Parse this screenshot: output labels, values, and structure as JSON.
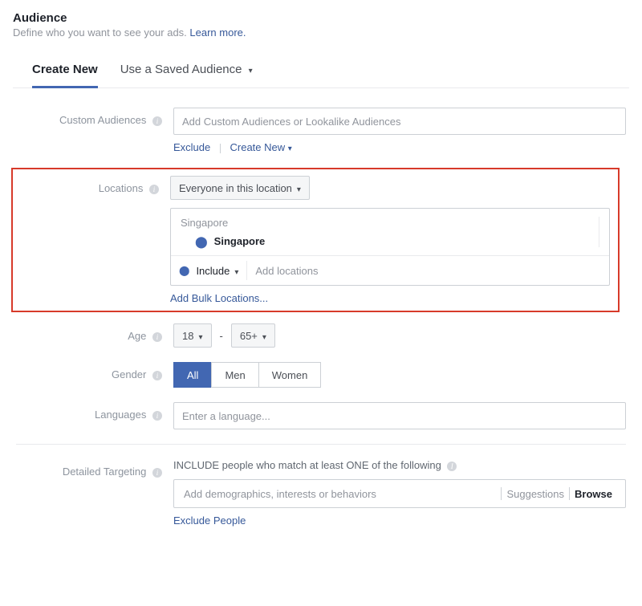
{
  "header": {
    "title": "Audience",
    "subtitle_prefix": "Define who you want to see your ads. ",
    "learn_more": "Learn more."
  },
  "tabs": {
    "create_new": "Create New",
    "saved": "Use a Saved Audience"
  },
  "custom": {
    "label": "Custom Audiences",
    "placeholder": "Add Custom Audiences or Lookalike Audiences",
    "exclude": "Exclude",
    "create_new": "Create New"
  },
  "locations": {
    "label": "Locations",
    "scope": "Everyone in this location",
    "region": "Singapore",
    "item": "Singapore",
    "include": "Include",
    "add_placeholder": "Add locations",
    "bulk": "Add Bulk Locations..."
  },
  "age": {
    "label": "Age",
    "min": "18",
    "max": "65+"
  },
  "gender": {
    "label": "Gender",
    "all": "All",
    "men": "Men",
    "women": "Women"
  },
  "languages": {
    "label": "Languages",
    "placeholder": "Enter a language..."
  },
  "targeting": {
    "label": "Detailed Targeting",
    "heading": "INCLUDE people who match at least ONE of the following",
    "placeholder": "Add demographics, interests or behaviors",
    "suggestions": "Suggestions",
    "browse": "Browse",
    "exclude": "Exclude People"
  }
}
